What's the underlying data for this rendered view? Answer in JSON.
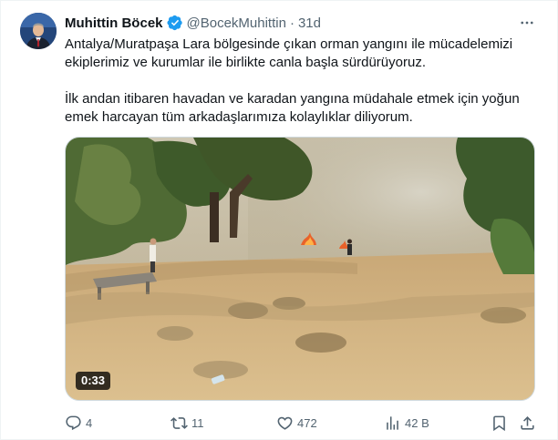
{
  "author": {
    "display_name": "Muhittin Böcek",
    "handle": "@BocekMuhittin",
    "separator": "·",
    "time": "31d",
    "verified": true
  },
  "tweet": {
    "paragraph_1": "Antalya/Muratpaşa Lara bölgesinde çıkan orman yangını ile mücadelemizi ekiplerimiz ve kurumlar ile birlikte canla başla sürdürüyoruz.",
    "paragraph_2": "İlk andan itibaren havadan ve karadan yangına müdahale etmek için yoğun emek harcayan tüm arkadaşlarımıza kolaylıklar diliyorum."
  },
  "media": {
    "type": "video",
    "duration": "0:33"
  },
  "actions": {
    "reply_count": "4",
    "retweet_count": "11",
    "like_count": "472",
    "views_count": "42 B"
  },
  "colors": {
    "verified_badge": "#1d9bf0",
    "muted_text": "#536471",
    "text": "#0f1419"
  },
  "icons": [
    "verified-badge-icon",
    "more-icon",
    "reply-icon",
    "retweet-icon",
    "like-icon",
    "views-icon",
    "bookmark-icon",
    "share-icon"
  ]
}
